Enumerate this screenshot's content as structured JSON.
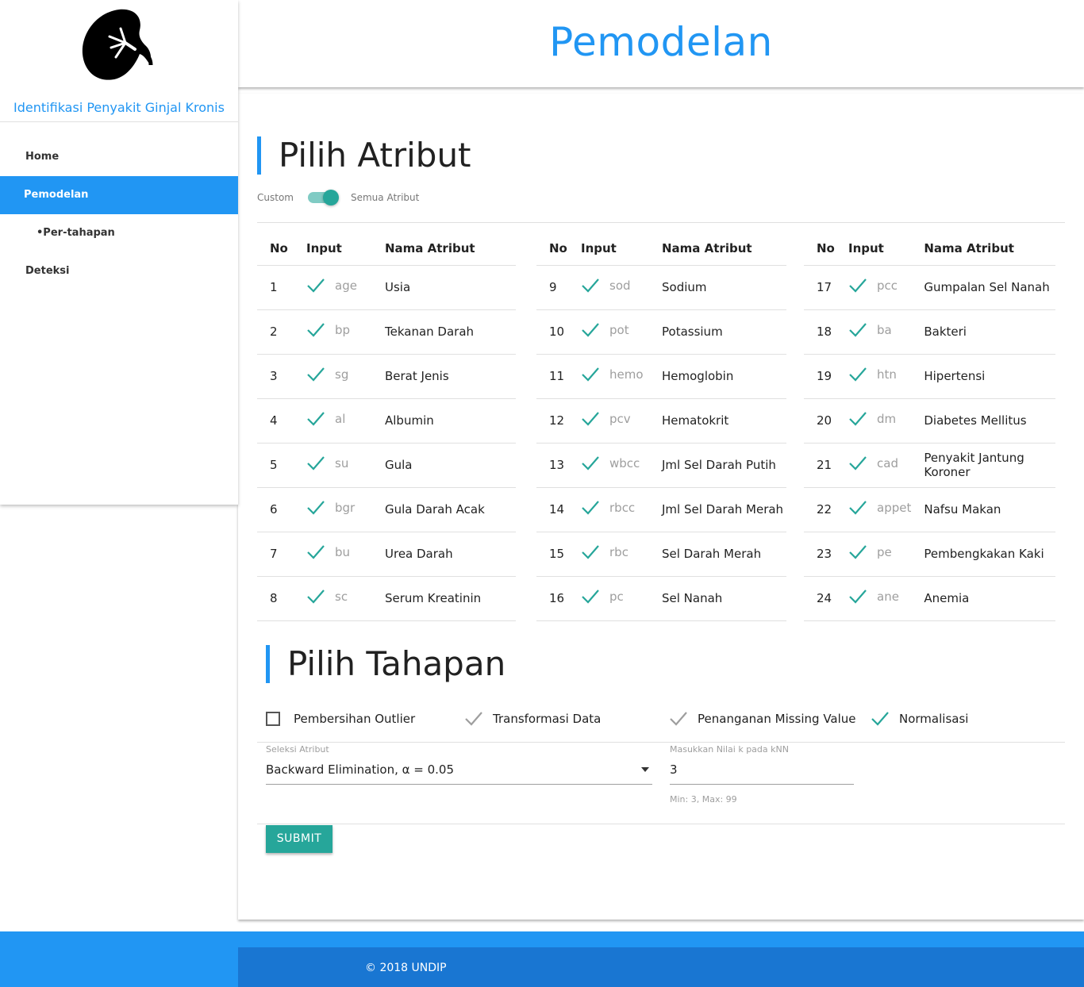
{
  "sidebar": {
    "app_title": "Identifikasi Penyakit Ginjal Kronis",
    "items": [
      {
        "label": "Home"
      },
      {
        "label": "Pemodelan"
      },
      {
        "label": "•Per-tahapan"
      },
      {
        "label": "Deteksi"
      }
    ]
  },
  "header": {
    "title": "Pemodelan"
  },
  "attributes": {
    "title": "Pilih Atribut",
    "switch_left": "Custom",
    "switch_right": "Semua Atribut",
    "switch_on": true,
    "col_no": "No",
    "col_input": "Input",
    "col_name": "Nama Atribut",
    "rows": [
      {
        "no": "1",
        "code": "age",
        "name": "Usia"
      },
      {
        "no": "2",
        "code": "bp",
        "name": "Tekanan Darah"
      },
      {
        "no": "3",
        "code": "sg",
        "name": "Berat Jenis"
      },
      {
        "no": "4",
        "code": "al",
        "name": "Albumin"
      },
      {
        "no": "5",
        "code": "su",
        "name": "Gula"
      },
      {
        "no": "6",
        "code": "bgr",
        "name": "Gula Darah Acak"
      },
      {
        "no": "7",
        "code": "bu",
        "name": "Urea Darah"
      },
      {
        "no": "8",
        "code": "sc",
        "name": "Serum Kreatinin"
      },
      {
        "no": "9",
        "code": "sod",
        "name": "Sodium"
      },
      {
        "no": "10",
        "code": "pot",
        "name": "Potassium"
      },
      {
        "no": "11",
        "code": "hemo",
        "name": "Hemoglobin"
      },
      {
        "no": "12",
        "code": "pcv",
        "name": "Hematokrit"
      },
      {
        "no": "13",
        "code": "wbcc",
        "name": "Jml Sel Darah Putih"
      },
      {
        "no": "14",
        "code": "rbcc",
        "name": "Jml Sel Darah Merah"
      },
      {
        "no": "15",
        "code": "rbc",
        "name": "Sel Darah Merah"
      },
      {
        "no": "16",
        "code": "pc",
        "name": "Sel Nanah"
      },
      {
        "no": "17",
        "code": "pcc",
        "name": "Gumpalan Sel Nanah"
      },
      {
        "no": "18",
        "code": "ba",
        "name": "Bakteri"
      },
      {
        "no": "19",
        "code": "htn",
        "name": "Hipertensi"
      },
      {
        "no": "20",
        "code": "dm",
        "name": "Diabetes Mellitus"
      },
      {
        "no": "21",
        "code": "cad",
        "name": "Penyakit Jantung Koroner"
      },
      {
        "no": "22",
        "code": "appet",
        "name": "Nafsu Makan"
      },
      {
        "no": "23",
        "code": "pe",
        "name": "Pembengkakan Kaki"
      },
      {
        "no": "24",
        "code": "ane",
        "name": "Anemia"
      }
    ]
  },
  "stages": {
    "title": "Pilih Tahapan",
    "items": [
      {
        "label": "Pembersihan Outlier",
        "checked": false,
        "check_color": "#555555"
      },
      {
        "label": "Transformasi Data",
        "checked": true,
        "check_color": "#9e9e9e"
      },
      {
        "label": "Penanganan Missing Value",
        "checked": true,
        "check_color": "#9e9e9e"
      },
      {
        "label": "Normalisasi",
        "checked": true,
        "check_color": "#26a69a"
      }
    ]
  },
  "form": {
    "select_label": "Seleksi Atribut",
    "select_value": "Backward Elimination, α = 0.05",
    "knn_label": "Masukkan Nilai k pada kNN",
    "knn_value": "3",
    "knn_helper": "Min: 3, Max: 99",
    "submit_label": "SUBMIT"
  },
  "footer": {
    "copyright": "© 2018 UNDIP"
  },
  "colors": {
    "primary": "#2196f3",
    "accent": "#26a69a",
    "footer_dark": "#1976d2"
  }
}
